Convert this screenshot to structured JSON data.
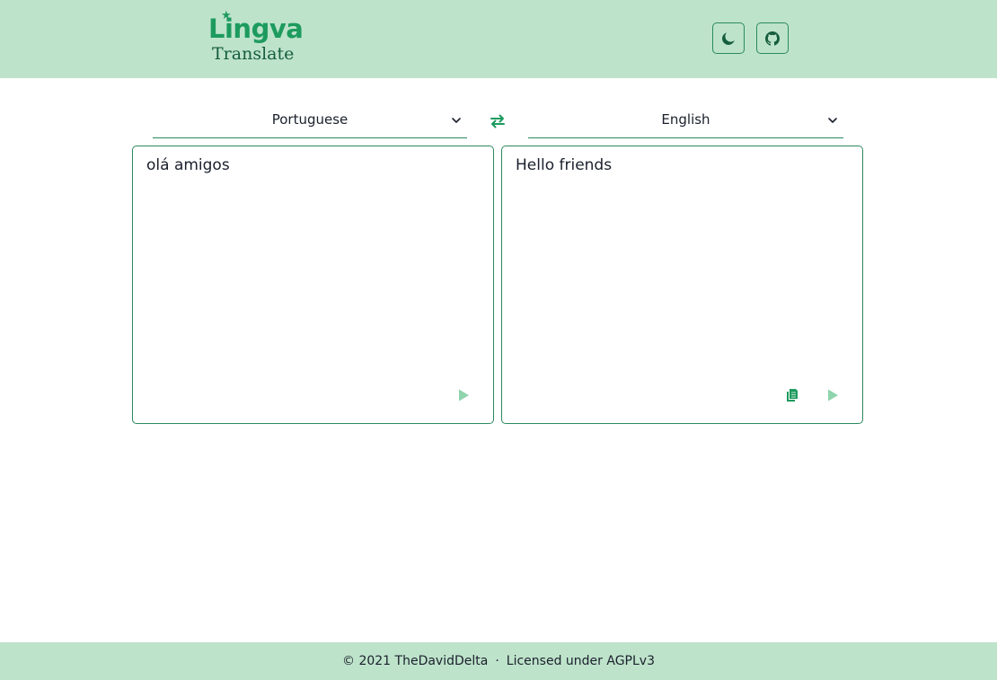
{
  "app": {
    "logo_word": "Lingva",
    "logo_sub": "Translate"
  },
  "header": {
    "theme_button": {
      "icon": "moon-icon"
    },
    "github_button": {
      "icon": "github-icon"
    }
  },
  "colors": {
    "accent": "#2b8a5e",
    "header_bg": "#bee3cb",
    "logo_green": "#1d9b5e",
    "play_disabled": "#8fd4ad"
  },
  "translator": {
    "source_language": "Portuguese",
    "target_language": "English",
    "source_text": "olá amigos",
    "translated_text": "Hello friends",
    "swap_icon": "swap-arrows-icon",
    "source_actions": [
      "play-icon"
    ],
    "target_actions": [
      "copy-icon",
      "play-icon"
    ]
  },
  "footer": {
    "copyright": "© 2021 TheDavidDelta",
    "separator": "·",
    "license": "Licensed under AGPLv3"
  }
}
